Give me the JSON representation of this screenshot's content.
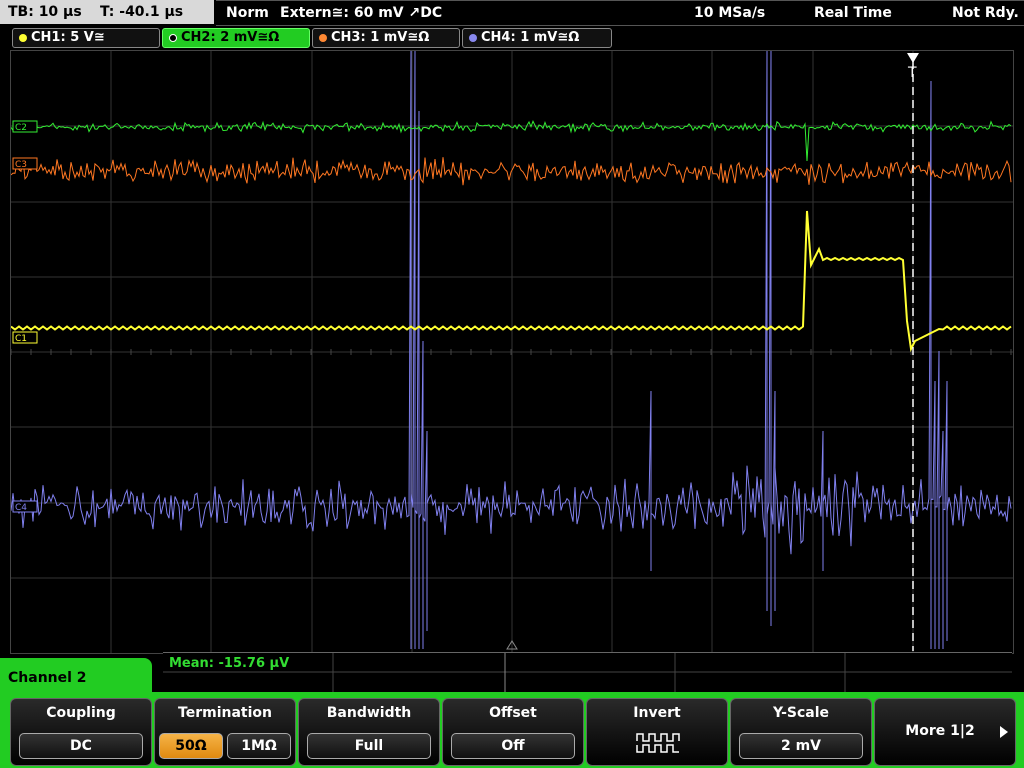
{
  "statusbar": {
    "timebase": "TB: 10 µs",
    "trigger_time": "T: -40.1 µs",
    "mode": "Norm",
    "trigger": "Extern≅: 60 mV ↗DC",
    "sample_rate": "10 MSa/s",
    "acq_mode": "Real Time",
    "status": "Not Rdy."
  },
  "channels": [
    {
      "label": "CH1: 5 V≅",
      "color": "#ffff33"
    },
    {
      "label": "CH2: 2 mV≅Ω",
      "color": "#33ee33"
    },
    {
      "label": "CH3: 1 mV≅Ω",
      "color": "#ff8833"
    },
    {
      "label": "CH4: 1 mV≅Ω",
      "color": "#8888ee"
    }
  ],
  "markers": {
    "c2": "C2",
    "c3": "C3",
    "c1": "C1",
    "c4": "C4"
  },
  "measurement": {
    "mean": "Mean: -15.76 µV"
  },
  "panel_title": "Channel 2",
  "softkeys": {
    "coupling": {
      "title": "Coupling",
      "value": "DC"
    },
    "termination": {
      "title": "Termination",
      "opt1": "50Ω",
      "opt2": "1MΩ"
    },
    "bandwidth": {
      "title": "Bandwidth",
      "value": "Full"
    },
    "offset": {
      "title": "Offset",
      "value": "Off"
    },
    "invert": {
      "title": "Invert"
    },
    "yscale": {
      "title": "Y-Scale",
      "value": "2 mV"
    },
    "more": {
      "label": "More 1|2"
    }
  },
  "colors": {
    "ch1": "#ffff33",
    "ch2": "#33ee33",
    "ch3": "#ff7722",
    "ch4": "#8080ee",
    "accent": "#22cc22"
  }
}
